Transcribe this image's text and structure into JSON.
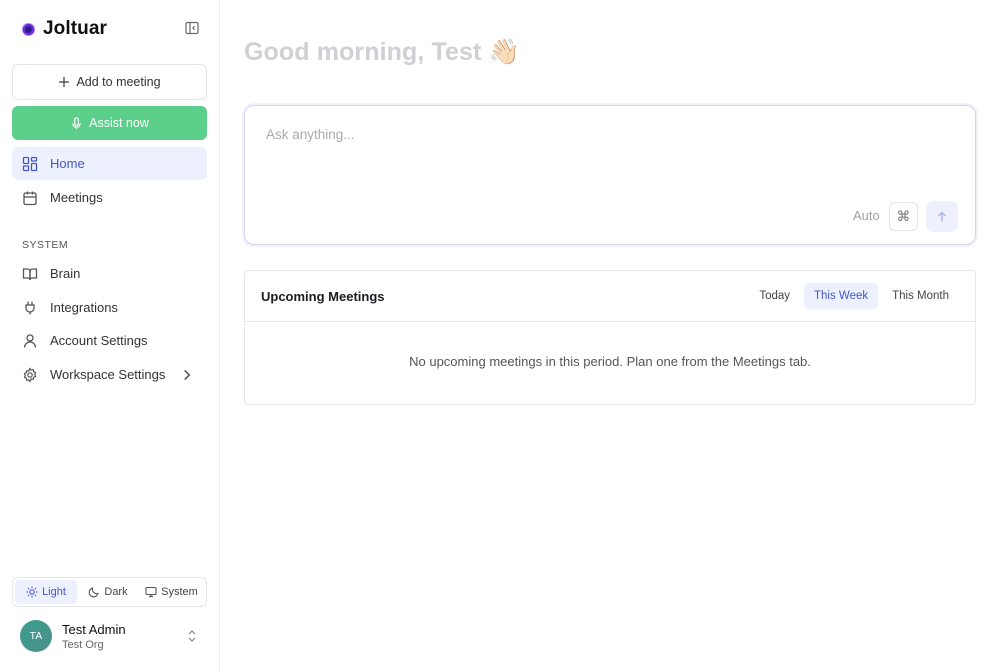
{
  "app": {
    "name": "Joltuar"
  },
  "sidebar": {
    "add_meeting_label": "Add to meeting",
    "assist_label": "Assist now",
    "nav": [
      {
        "label": "Home",
        "icon": "grid-icon",
        "active": true
      },
      {
        "label": "Meetings",
        "icon": "calendar-icon",
        "active": false
      }
    ],
    "system_label": "SYSTEM",
    "system_nav": [
      {
        "label": "Brain",
        "icon": "book-icon"
      },
      {
        "label": "Integrations",
        "icon": "plug-icon"
      },
      {
        "label": "Account Settings",
        "icon": "user-icon"
      },
      {
        "label": "Workspace Settings",
        "icon": "gear-icon"
      }
    ],
    "theme": {
      "options": [
        "Light",
        "Dark",
        "System"
      ],
      "selected": "Light"
    },
    "user": {
      "initials": "TA",
      "name": "Test Admin",
      "org": "Test Org"
    }
  },
  "main": {
    "greeting": "Good morning, Test 👋🏻",
    "ask": {
      "placeholder": "Ask anything...",
      "mode": "Auto",
      "cmd_symbol": "⌘"
    },
    "meetings": {
      "title": "Upcoming Meetings",
      "tabs": [
        "Today",
        "This Week",
        "This Month"
      ],
      "active_tab": "This Week",
      "empty_text": "No upcoming meetings in this period. Plan one from the Meetings tab."
    }
  },
  "colors": {
    "accent": "#4457c9",
    "accent_bg": "#edf0fe",
    "assist_green": "#5ccf8a"
  }
}
